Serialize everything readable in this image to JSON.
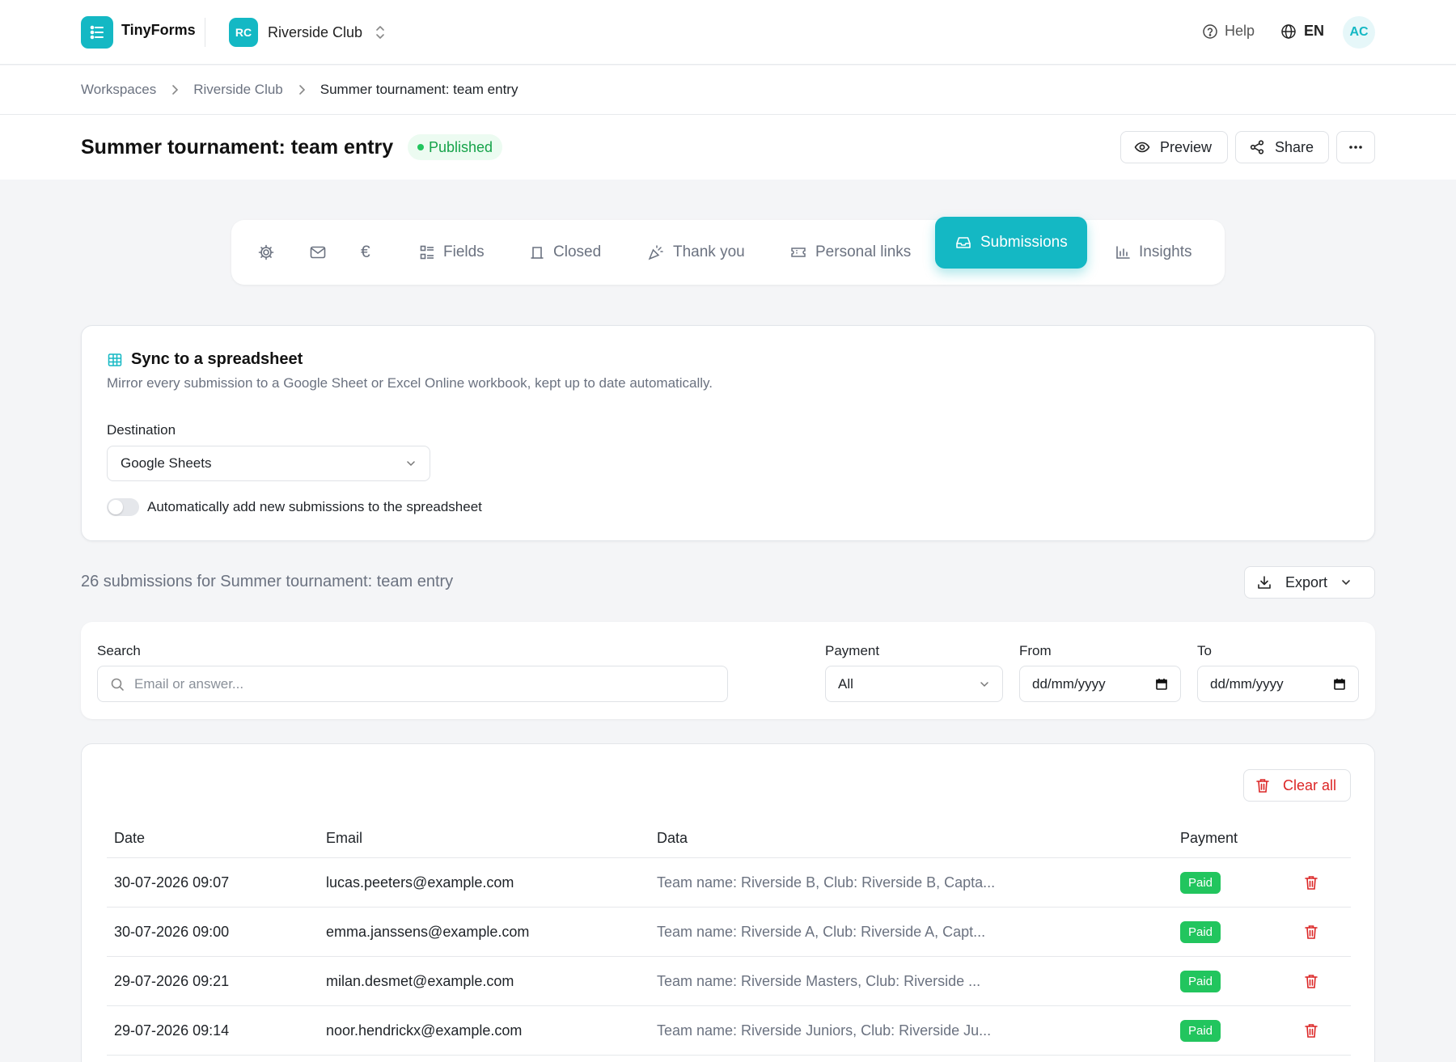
{
  "app": {
    "name": "TinyForms",
    "logo_icon": "list-form-icon"
  },
  "workspace": {
    "initials": "RC",
    "name": "Riverside Club"
  },
  "header": {
    "help_label": "Help",
    "language": "EN",
    "user_initials": "AC"
  },
  "breadcrumb": [
    "Workspaces",
    "Riverside Club",
    "Summer tournament: team entry"
  ],
  "form": {
    "title": "Summer tournament: team entry",
    "status": "Published",
    "actions": {
      "preview": "Preview",
      "share": "Share"
    }
  },
  "tabs": [
    {
      "icon": "gear-icon",
      "label": ""
    },
    {
      "icon": "mail-icon",
      "label": ""
    },
    {
      "icon": "euro-icon",
      "label": ""
    },
    {
      "icon": "fields-icon",
      "label": "Fields"
    },
    {
      "icon": "closed-icon",
      "label": "Closed"
    },
    {
      "icon": "party-icon",
      "label": "Thank you"
    },
    {
      "icon": "ticket-icon",
      "label": "Personal links"
    },
    {
      "icon": "inbox-icon",
      "label": "Submissions",
      "active": true
    },
    {
      "icon": "bar-chart-icon",
      "label": "Insights"
    }
  ],
  "sync": {
    "title": "Sync to a spreadsheet",
    "description": "Mirror every submission to a Google Sheet or Excel Online workbook, kept up to date automatically.",
    "destination_label": "Destination",
    "destination_value": "Google Sheets",
    "auto_add_label": "Automatically add new submissions to the spreadsheet",
    "auto_add_enabled": false
  },
  "submissions": {
    "count_text": "26 submissions for Summer tournament: team entry",
    "export_label": "Export"
  },
  "filters": {
    "search_label": "Search",
    "search_placeholder": "Email or answer...",
    "payment_label": "Payment",
    "payment_value": "All",
    "from_label": "From",
    "from_placeholder": "dd/mm/yyyy",
    "to_label": "To",
    "to_placeholder": "dd/mm/yyyy"
  },
  "table": {
    "clear_all_label": "Clear all",
    "columns": [
      "Date",
      "Email",
      "Data",
      "Payment"
    ],
    "rows": [
      {
        "date": "30-07-2026 09:07",
        "email": "lucas.peeters@example.com",
        "data": "Team name: Riverside B, Club: Riverside B, Capta...",
        "payment": "Paid"
      },
      {
        "date": "30-07-2026 09:00",
        "email": "emma.janssens@example.com",
        "data": "Team name: Riverside A, Club: Riverside A, Capt...",
        "payment": "Paid"
      },
      {
        "date": "29-07-2026 09:21",
        "email": "milan.desmet@example.com",
        "data": "Team name: Riverside Masters, Club: Riverside ...",
        "payment": "Paid"
      },
      {
        "date": "29-07-2026 09:14",
        "email": "noor.hendrickx@example.com",
        "data": "Team name: Riverside Juniors, Club: Riverside Ju...",
        "payment": "Paid"
      }
    ]
  },
  "colors": {
    "accent": "#14b8c4",
    "success": "#22c55e",
    "danger": "#dc2626"
  }
}
